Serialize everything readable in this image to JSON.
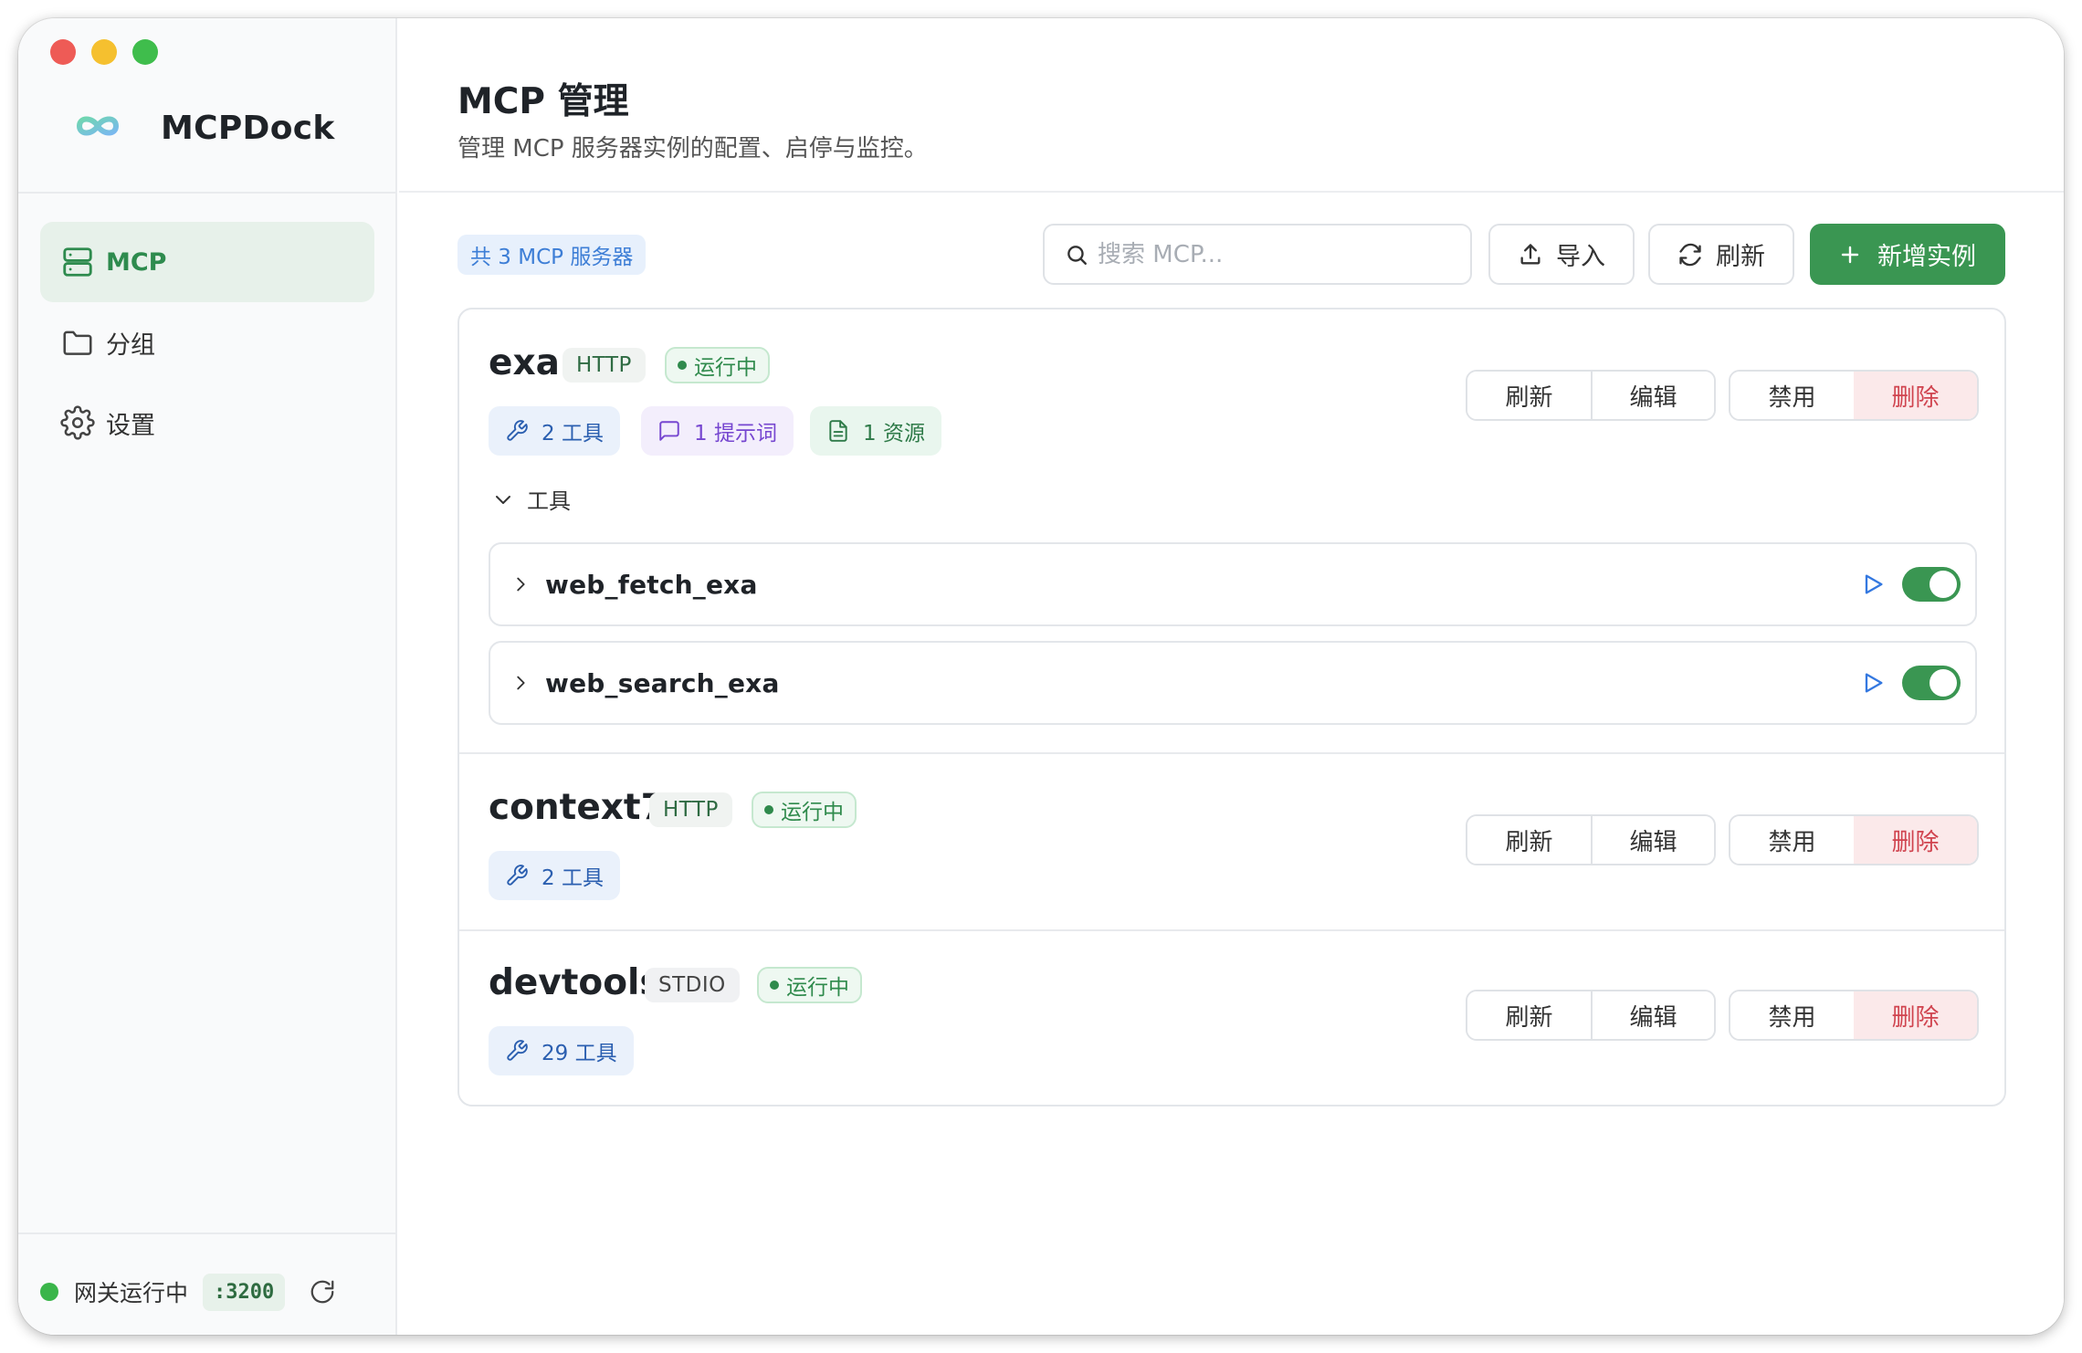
{
  "colors": {
    "accent": "#3a9652",
    "danger": "#d0444f",
    "info": "#3d7ed6"
  },
  "app": {
    "name": "MCPDock"
  },
  "sidebar": {
    "items": [
      {
        "label": "MCP",
        "icon": "server-icon",
        "active": true
      },
      {
        "label": "分组",
        "icon": "folder-icon",
        "active": false
      },
      {
        "label": "设置",
        "icon": "gear-icon",
        "active": false
      }
    ],
    "footer": {
      "status": "网关运行中",
      "port": ":3200"
    }
  },
  "header": {
    "title": "MCP 管理",
    "subtitle": "管理 MCP 服务器实例的配置、启停与监控。"
  },
  "toolbar": {
    "count_label": "共 3 MCP 服务器",
    "search_placeholder": "搜索 MCP...",
    "import_label": "导入",
    "refresh_label": "刷新",
    "add_label": "新增实例"
  },
  "actions": {
    "refresh": "刷新",
    "edit": "编辑",
    "disable": "禁用",
    "delete": "删除"
  },
  "servers": [
    {
      "name": "exa",
      "type": "HTTP",
      "status": "运行中",
      "tools_chip": "2 工具",
      "prompts_chip": "1 提示词",
      "resources_chip": "1 资源",
      "tools_section_label": "工具",
      "tools": [
        {
          "name": "web_fetch_exa",
          "enabled": true
        },
        {
          "name": "web_search_exa",
          "enabled": true
        }
      ]
    },
    {
      "name": "context7",
      "type": "HTTP",
      "status": "运行中",
      "tools_chip": "2 工具"
    },
    {
      "name": "devtools",
      "type": "STDIO",
      "status": "运行中",
      "tools_chip": "29 工具"
    }
  ]
}
